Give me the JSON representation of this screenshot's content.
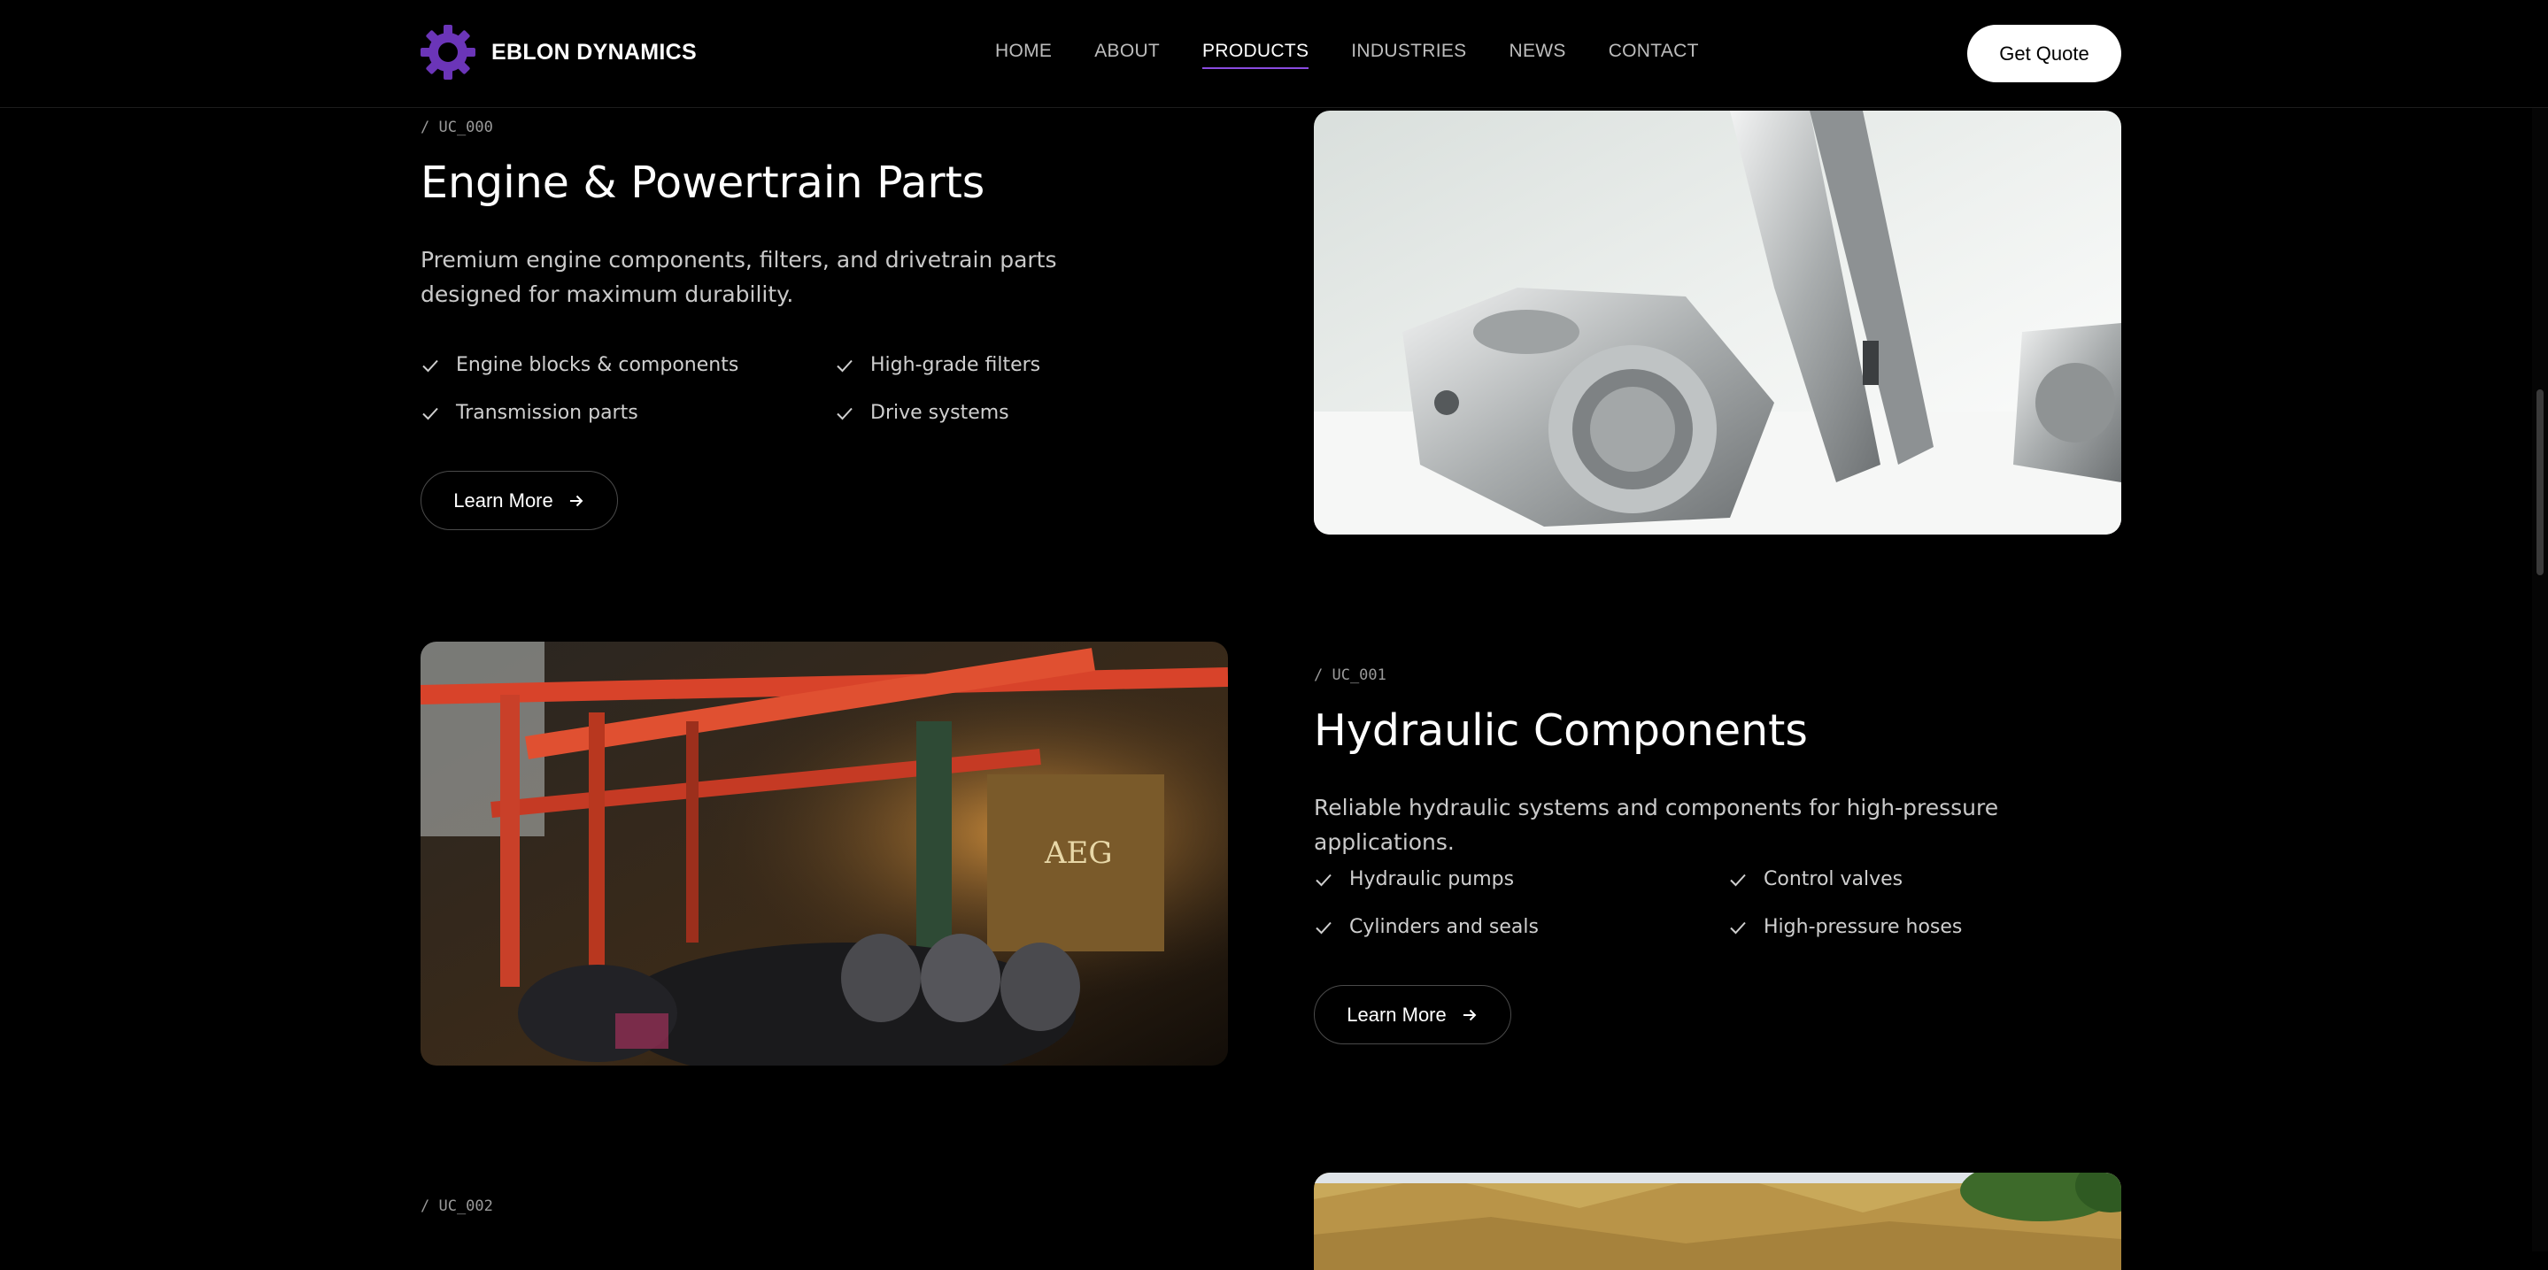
{
  "brand": {
    "name": "EBLON DYNAMICS",
    "accent": "#6b35b8"
  },
  "nav": {
    "items": [
      "HOME",
      "ABOUT",
      "PRODUCTS",
      "INDUSTRIES",
      "NEWS",
      "CONTACT"
    ],
    "active": "PRODUCTS"
  },
  "header": {
    "cta_label": "Get Quote"
  },
  "sections": [
    {
      "code": "/  UC_000",
      "title": "Engine & Powertrain Parts",
      "description": "Premium engine components, filters, and drivetrain parts designed for maximum durability.",
      "features": [
        "Engine blocks & components",
        "High-grade filters",
        "Transmission parts",
        "Drive systems"
      ],
      "button": "Learn More"
    },
    {
      "code": "/  UC_001",
      "title": "Hydraulic Components",
      "description": "Reliable hydraulic systems and components for high-pressure applications.",
      "features": [
        "Hydraulic pumps",
        "Control valves",
        "Cylinders and seals",
        "High-pressure hoses"
      ],
      "button": "Learn More"
    },
    {
      "code": "/  UC_002"
    }
  ],
  "icons": {
    "check": "check-icon",
    "arrow": "arrow-right-icon",
    "logo": "gear-logo-icon"
  }
}
